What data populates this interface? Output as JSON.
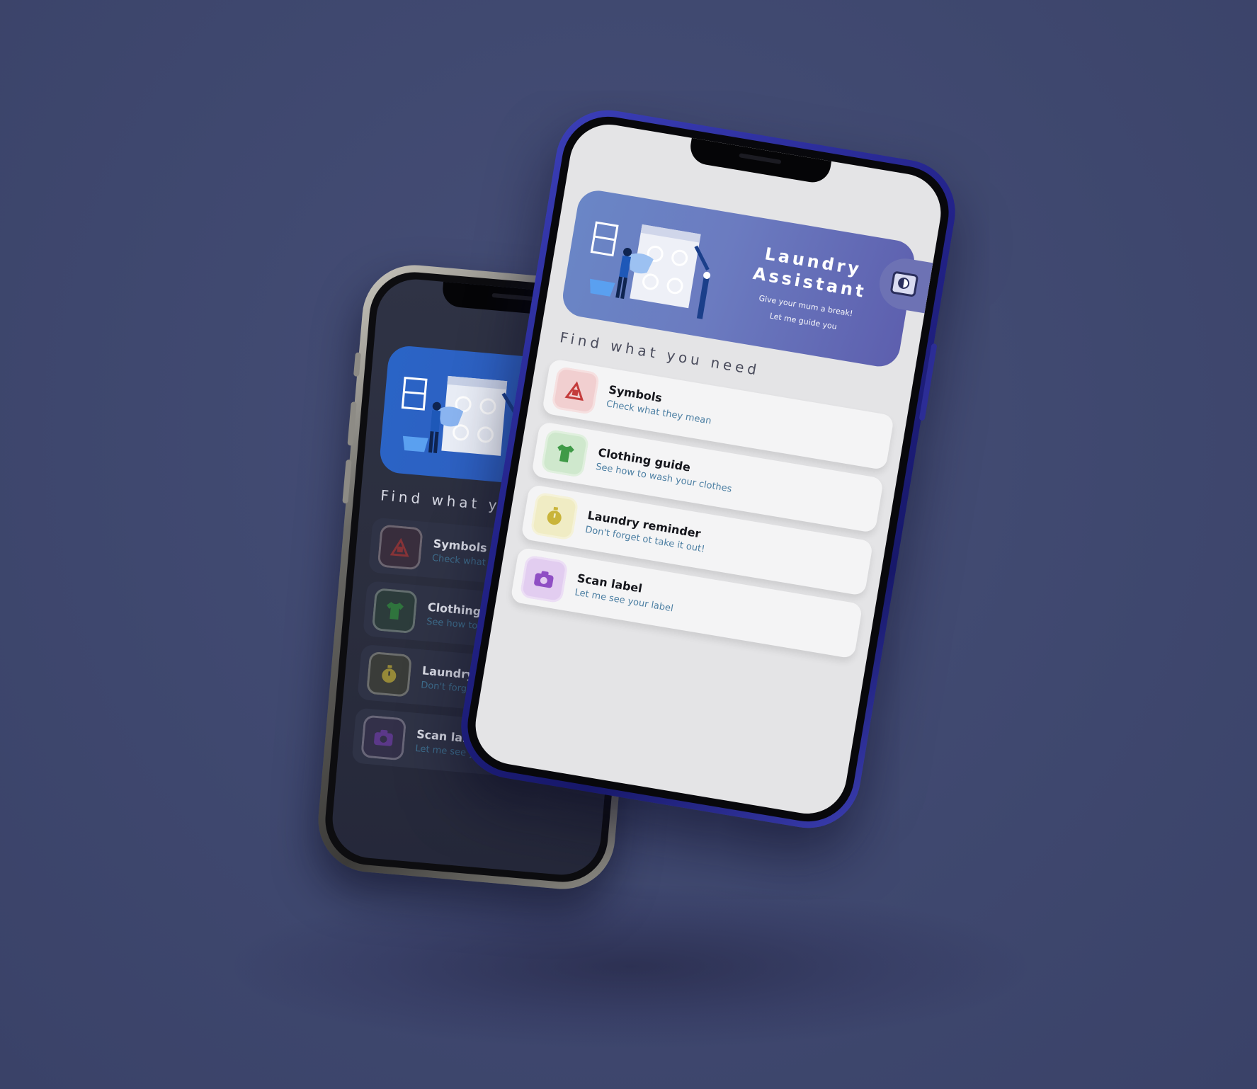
{
  "app": {
    "title_line1": "Laundry",
    "title_line2": "Assistant",
    "subtitle_line1": "Give your mum a break!",
    "subtitle_line2": "Let me guide you",
    "section_title": "Find what you need"
  },
  "menu": [
    {
      "title": "Symbols",
      "subtitle": "Check what they mean",
      "icon": "symbols-icon",
      "color": "#c43b3b",
      "tile": "#f1cfd0"
    },
    {
      "title": "Clothing guide",
      "subtitle": "See how to wash your clothes",
      "icon": "tshirt-icon",
      "color": "#3f9a47",
      "tile": "#cfe8cd"
    },
    {
      "title": "Laundry reminder",
      "subtitle": "Don't forget ot take it out!",
      "icon": "stopwatch-icon",
      "color": "#c9b43a",
      "tile": "#f0ecc4"
    },
    {
      "title": "Scan label",
      "subtitle": "Let me see your label",
      "icon": "camera-icon",
      "color": "#8f4fc4",
      "tile": "#e2cdf0"
    }
  ],
  "theme_toggle": {
    "icon": "theme-toggle-icon"
  },
  "colors": {
    "background": "#414a72",
    "front_frame": "#23238a",
    "hero_light": "#6a86c6",
    "hero_dark": "#2a64c6"
  }
}
